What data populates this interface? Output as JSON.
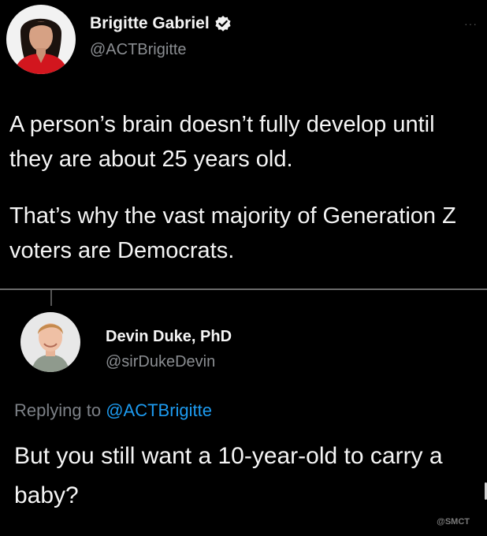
{
  "original_tweet": {
    "author_name": "Brigitte Gabriel",
    "handle": "@ACTBrigitte",
    "more_label": "···",
    "paragraphs": [
      "A person’s brain doesn’t fully develop until they are about 25 years old.",
      "That’s why the vast majority of Generation Z voters are Democrats."
    ]
  },
  "reply_tweet": {
    "author_name": "Devin Duke, PhD",
    "handle": "@sirDukeDevin",
    "replying_prefix": "Replying to",
    "replying_handle": "@ACTBrigitte",
    "text": "But you still want a 10-year-old to carry a baby?"
  },
  "watermark": "@SMCT",
  "colors": {
    "background": "#000000",
    "text": "#f5f5f5",
    "secondary_text": "#8a8d91",
    "accent": "#1d9bf0",
    "divider": "#6a6a6a"
  },
  "icons": {
    "verified": "verified-badge-icon",
    "more": "more-options-icon"
  }
}
